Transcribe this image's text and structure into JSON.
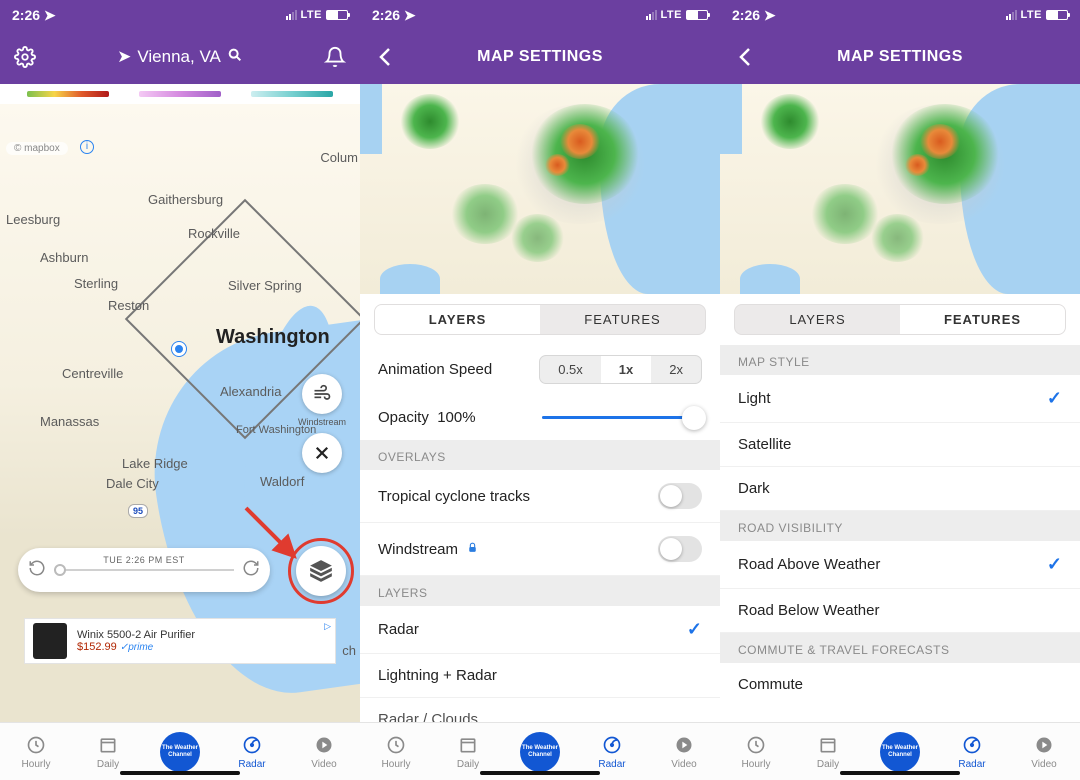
{
  "status": {
    "time": "2:26",
    "carrier": "LTE"
  },
  "screen1": {
    "location": "Vienna, VA",
    "mapbox_credit": "© mapbox",
    "timeline": "TUE 2:26 PM EST",
    "windstream_label": "Windstream",
    "labels": {
      "columbia": "Colum",
      "gaithersburg": "Gaithersburg",
      "leesburg": "Leesburg",
      "rockville": "Rockville",
      "ashburn": "Ashburn",
      "silverspring": "Silver Spring",
      "sterling": "Sterling",
      "reston": "Reston",
      "washington": "Washington",
      "centreville": "Centreville",
      "alexandria": "Alexandria",
      "manassas": "Manassas",
      "fortwash": "Fort Washington",
      "lakeridge": "Lake Ridge",
      "waldorf": "Waldorf",
      "dalecity": "Dale City",
      "i95a": "95",
      "i95b": "95",
      "chesb": "ch"
    },
    "ad": {
      "title": "Winix 5500-2 Air Purifier",
      "price": "$152.99",
      "prime": "✓prime"
    }
  },
  "screen2": {
    "title": "MAP SETTINGS",
    "tabs": {
      "layers": "LAYERS",
      "features": "FEATURES"
    },
    "anim_label": "Animation Speed",
    "speeds": {
      "half": "0.5x",
      "one": "1x",
      "two": "2x"
    },
    "opacity_label": "Opacity",
    "opacity_value": "100%",
    "sections": {
      "overlays": "OVERLAYS",
      "layers": "LAYERS"
    },
    "items": {
      "tropical": "Tropical cyclone tracks",
      "windstream": "Windstream",
      "radar": "Radar",
      "lightning": "Lightning + Radar",
      "radarclouds": "Radar / Clouds"
    }
  },
  "screen3": {
    "title": "MAP SETTINGS",
    "tabs": {
      "layers": "LAYERS",
      "features": "FEATURES"
    },
    "sections": {
      "mapstyle": "MAP STYLE",
      "roadvis": "ROAD VISIBILITY",
      "commute": "COMMUTE & TRAVEL FORECASTS"
    },
    "items": {
      "light": "Light",
      "satellite": "Satellite",
      "dark": "Dark",
      "roadabove": "Road Above Weather",
      "roadbelow": "Road Below Weather",
      "commute": "Commute"
    }
  },
  "tabs": {
    "hourly": "Hourly",
    "daily": "Daily",
    "radar": "Radar",
    "video": "Video",
    "twc": "The Weather Channel"
  }
}
